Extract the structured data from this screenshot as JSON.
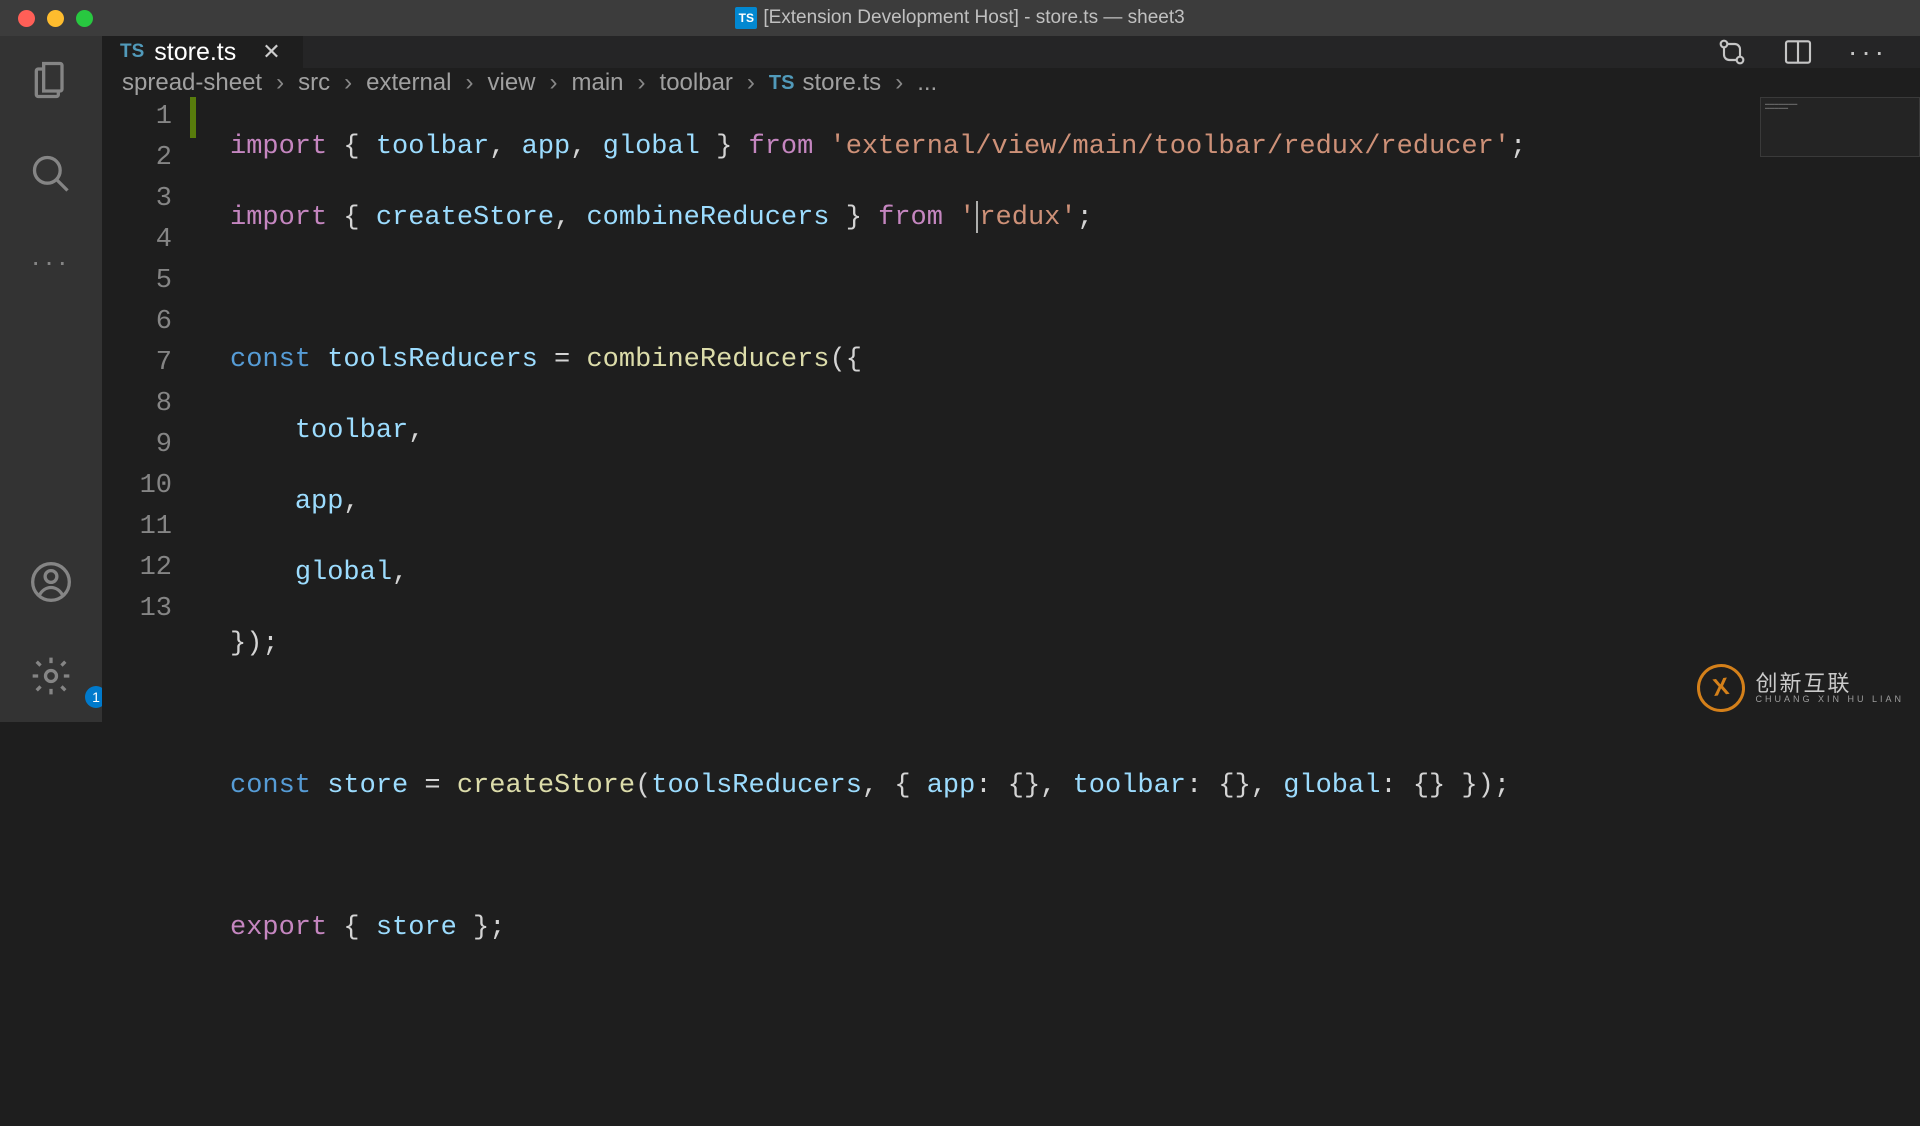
{
  "window": {
    "title": "[Extension Development Host] - store.ts — sheet3",
    "fileicon_label": "TS"
  },
  "activity": {
    "badge": "1"
  },
  "tab": {
    "icon": "TS",
    "title": "store.ts"
  },
  "breadcrumbs": {
    "items": [
      "spread-sheet",
      "src",
      "external",
      "view",
      "main",
      "toolbar"
    ],
    "file_icon": "TS",
    "file": "store.ts",
    "tail": "..."
  },
  "code": {
    "lines": [
      "1",
      "2",
      "3",
      "4",
      "5",
      "6",
      "7",
      "8",
      "9",
      "10",
      "11",
      "12",
      "13"
    ],
    "l1": {
      "kw": "import",
      "brace_o": " { ",
      "id1": "toolbar",
      "c1": ", ",
      "id2": "app",
      "c2": ", ",
      "id3": "global",
      "brace_c": " } ",
      "from": "from ",
      "str": "'external/view/main/toolbar/redux/reducer'",
      "end": ";"
    },
    "l2": {
      "kw": "import",
      "brace_o": " { ",
      "id1": "createStore",
      "c1": ", ",
      "id2": "combineReducers",
      "brace_c": " } ",
      "from": "from ",
      "str_a": "'",
      "str_b": "redux'",
      "end": ";"
    },
    "l4": {
      "storage": "const ",
      "id": "toolsReducers",
      "eq": " = ",
      "fn": "combineReducers",
      "paren": "({"
    },
    "l5": {
      "indent": "    ",
      "id": "toolbar",
      "c": ","
    },
    "l6": {
      "indent": "    ",
      "id": "app",
      "c": ","
    },
    "l7": {
      "indent": "    ",
      "id": "global",
      "c": ","
    },
    "l8": {
      "close": "});"
    },
    "l10": {
      "storage": "const ",
      "id": "store",
      "eq": " = ",
      "fn": "createStore",
      "paren_o": "(",
      "arg1": "toolsReducers",
      "c1": ", { ",
      "k1": "app",
      "v1": ": {}, ",
      "k2": "toolbar",
      "v2": ": {}, ",
      "k3": "global",
      "v3": ": {} });"
    },
    "l12": {
      "kw": "export",
      "brace_o": " { ",
      "id": "store",
      "brace_c": " };"
    }
  },
  "watermark": {
    "cn": "创新互联",
    "py": "CHUANG XIN HU LIAN"
  }
}
